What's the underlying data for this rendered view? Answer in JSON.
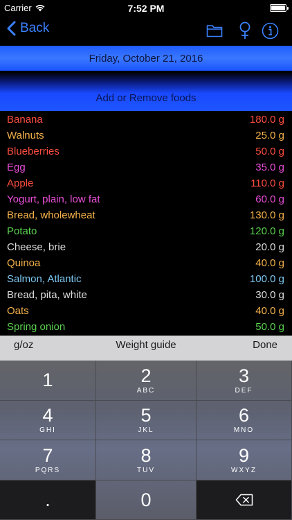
{
  "status_bar": {
    "carrier": "Carrier",
    "time": "7:52 PM"
  },
  "nav": {
    "back_label": "Back",
    "icons": [
      "folder-icon",
      "female-symbol-icon",
      "info-icon"
    ],
    "accent": "#3b82ff"
  },
  "date_bar": {
    "label": "Friday, October 21, 2016"
  },
  "add_bar": {
    "label": "Add or Remove foods"
  },
  "foods": [
    {
      "name": "Banana",
      "amount": "180.0 g",
      "color": "#ff4d40"
    },
    {
      "name": "Walnuts",
      "amount": "25.0 g",
      "color": "#f6b24b"
    },
    {
      "name": "Blueberries",
      "amount": "50.0 g",
      "color": "#ff4d40"
    },
    {
      "name": "Egg",
      "amount": "35.0 g",
      "color": "#e84ed7"
    },
    {
      "name": "Apple",
      "amount": "110.0 g",
      "color": "#ff4d40"
    },
    {
      "name": "Yogurt, plain, low fat",
      "amount": "60.0 g",
      "color": "#e84ed7"
    },
    {
      "name": "Bread, wholewheat",
      "amount": "130.0 g",
      "color": "#f6b24b"
    },
    {
      "name": "Potato",
      "amount": "120.0 g",
      "color": "#5bd24f"
    },
    {
      "name": "Cheese, brie",
      "amount": "20.0 g",
      "color": "#dcdcdc"
    },
    {
      "name": "Quinoa",
      "amount": "40.0 g",
      "color": "#f6b24b"
    },
    {
      "name": "Salmon, Atlantic",
      "amount": "100.0 g",
      "color": "#7ec8f2"
    },
    {
      "name": "Bread, pita, white",
      "amount": "30.0 g",
      "color": "#dcdcdc"
    },
    {
      "name": "Oats",
      "amount": "40.0 g",
      "color": "#f6b24b"
    },
    {
      "name": "Spring onion",
      "amount": "50.0 g",
      "color": "#5bd24f"
    }
  ],
  "keyboard_toolbar": {
    "unit_toggle": "g/oz",
    "guide": "Weight guide",
    "done": "Done"
  },
  "keypad": {
    "keys": [
      {
        "num": "1",
        "letters": ""
      },
      {
        "num": "2",
        "letters": "ABC"
      },
      {
        "num": "3",
        "letters": "DEF"
      },
      {
        "num": "4",
        "letters": "GHI"
      },
      {
        "num": "5",
        "letters": "JKL"
      },
      {
        "num": "6",
        "letters": "MNO"
      },
      {
        "num": "7",
        "letters": "PQRS"
      },
      {
        "num": "8",
        "letters": "TUV"
      },
      {
        "num": "9",
        "letters": "WXYZ"
      },
      {
        "num": ".",
        "letters": ""
      },
      {
        "num": "0",
        "letters": ""
      },
      {
        "num": "",
        "letters": "",
        "icon": "backspace-icon"
      }
    ]
  }
}
